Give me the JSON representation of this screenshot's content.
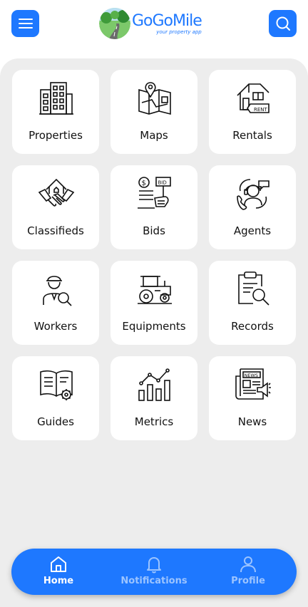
{
  "header": {
    "logo_title": "GoGoMile",
    "logo_subtitle": "your property app"
  },
  "tiles": [
    {
      "label": "Properties",
      "icon": "building-icon"
    },
    {
      "label": "Maps",
      "icon": "map-pin-icon"
    },
    {
      "label": "Rentals",
      "icon": "rent-house-icon"
    },
    {
      "label": "Classifieds",
      "icon": "handshake-house-icon"
    },
    {
      "label": "Bids",
      "icon": "bid-icon"
    },
    {
      "label": "Agents",
      "icon": "agent-headset-icon"
    },
    {
      "label": "Workers",
      "icon": "worker-icon"
    },
    {
      "label": "Equipments",
      "icon": "tractor-icon"
    },
    {
      "label": "Records",
      "icon": "clipboard-search-icon"
    },
    {
      "label": "Guides",
      "icon": "book-gear-icon"
    },
    {
      "label": "Metrics",
      "icon": "bar-chart-icon"
    },
    {
      "label": "News",
      "icon": "newspaper-icon"
    }
  ],
  "nav": {
    "home": "Home",
    "notifications": "Notifications",
    "profile": "Profile"
  },
  "colors": {
    "accent": "#1e78ff",
    "panel_bg": "#ededed",
    "inactive_nav": "#9cc4ff"
  }
}
